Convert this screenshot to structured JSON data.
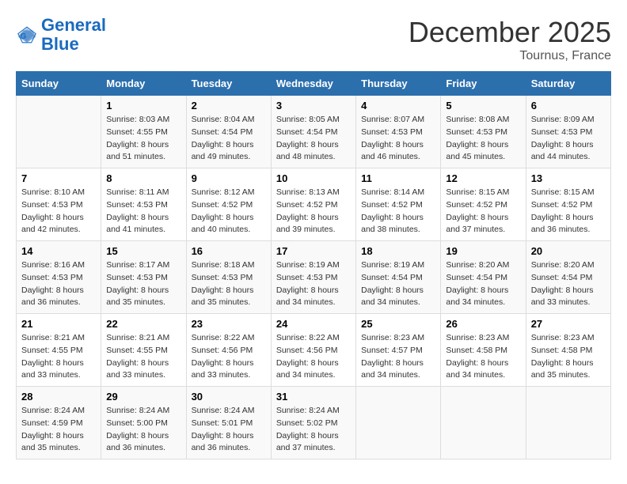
{
  "header": {
    "logo_general": "General",
    "logo_blue": "Blue",
    "month": "December 2025",
    "location": "Tournus, France"
  },
  "days_of_week": [
    "Sunday",
    "Monday",
    "Tuesday",
    "Wednesday",
    "Thursday",
    "Friday",
    "Saturday"
  ],
  "weeks": [
    [
      {
        "day": "",
        "sunrise": "",
        "sunset": "",
        "daylight": ""
      },
      {
        "day": "1",
        "sunrise": "Sunrise: 8:03 AM",
        "sunset": "Sunset: 4:55 PM",
        "daylight": "Daylight: 8 hours and 51 minutes."
      },
      {
        "day": "2",
        "sunrise": "Sunrise: 8:04 AM",
        "sunset": "Sunset: 4:54 PM",
        "daylight": "Daylight: 8 hours and 49 minutes."
      },
      {
        "day": "3",
        "sunrise": "Sunrise: 8:05 AM",
        "sunset": "Sunset: 4:54 PM",
        "daylight": "Daylight: 8 hours and 48 minutes."
      },
      {
        "day": "4",
        "sunrise": "Sunrise: 8:07 AM",
        "sunset": "Sunset: 4:53 PM",
        "daylight": "Daylight: 8 hours and 46 minutes."
      },
      {
        "day": "5",
        "sunrise": "Sunrise: 8:08 AM",
        "sunset": "Sunset: 4:53 PM",
        "daylight": "Daylight: 8 hours and 45 minutes."
      },
      {
        "day": "6",
        "sunrise": "Sunrise: 8:09 AM",
        "sunset": "Sunset: 4:53 PM",
        "daylight": "Daylight: 8 hours and 44 minutes."
      }
    ],
    [
      {
        "day": "7",
        "sunrise": "Sunrise: 8:10 AM",
        "sunset": "Sunset: 4:53 PM",
        "daylight": "Daylight: 8 hours and 42 minutes."
      },
      {
        "day": "8",
        "sunrise": "Sunrise: 8:11 AM",
        "sunset": "Sunset: 4:53 PM",
        "daylight": "Daylight: 8 hours and 41 minutes."
      },
      {
        "day": "9",
        "sunrise": "Sunrise: 8:12 AM",
        "sunset": "Sunset: 4:52 PM",
        "daylight": "Daylight: 8 hours and 40 minutes."
      },
      {
        "day": "10",
        "sunrise": "Sunrise: 8:13 AM",
        "sunset": "Sunset: 4:52 PM",
        "daylight": "Daylight: 8 hours and 39 minutes."
      },
      {
        "day": "11",
        "sunrise": "Sunrise: 8:14 AM",
        "sunset": "Sunset: 4:52 PM",
        "daylight": "Daylight: 8 hours and 38 minutes."
      },
      {
        "day": "12",
        "sunrise": "Sunrise: 8:15 AM",
        "sunset": "Sunset: 4:52 PM",
        "daylight": "Daylight: 8 hours and 37 minutes."
      },
      {
        "day": "13",
        "sunrise": "Sunrise: 8:15 AM",
        "sunset": "Sunset: 4:52 PM",
        "daylight": "Daylight: 8 hours and 36 minutes."
      }
    ],
    [
      {
        "day": "14",
        "sunrise": "Sunrise: 8:16 AM",
        "sunset": "Sunset: 4:53 PM",
        "daylight": "Daylight: 8 hours and 36 minutes."
      },
      {
        "day": "15",
        "sunrise": "Sunrise: 8:17 AM",
        "sunset": "Sunset: 4:53 PM",
        "daylight": "Daylight: 8 hours and 35 minutes."
      },
      {
        "day": "16",
        "sunrise": "Sunrise: 8:18 AM",
        "sunset": "Sunset: 4:53 PM",
        "daylight": "Daylight: 8 hours and 35 minutes."
      },
      {
        "day": "17",
        "sunrise": "Sunrise: 8:19 AM",
        "sunset": "Sunset: 4:53 PM",
        "daylight": "Daylight: 8 hours and 34 minutes."
      },
      {
        "day": "18",
        "sunrise": "Sunrise: 8:19 AM",
        "sunset": "Sunset: 4:54 PM",
        "daylight": "Daylight: 8 hours and 34 minutes."
      },
      {
        "day": "19",
        "sunrise": "Sunrise: 8:20 AM",
        "sunset": "Sunset: 4:54 PM",
        "daylight": "Daylight: 8 hours and 34 minutes."
      },
      {
        "day": "20",
        "sunrise": "Sunrise: 8:20 AM",
        "sunset": "Sunset: 4:54 PM",
        "daylight": "Daylight: 8 hours and 33 minutes."
      }
    ],
    [
      {
        "day": "21",
        "sunrise": "Sunrise: 8:21 AM",
        "sunset": "Sunset: 4:55 PM",
        "daylight": "Daylight: 8 hours and 33 minutes."
      },
      {
        "day": "22",
        "sunrise": "Sunrise: 8:21 AM",
        "sunset": "Sunset: 4:55 PM",
        "daylight": "Daylight: 8 hours and 33 minutes."
      },
      {
        "day": "23",
        "sunrise": "Sunrise: 8:22 AM",
        "sunset": "Sunset: 4:56 PM",
        "daylight": "Daylight: 8 hours and 33 minutes."
      },
      {
        "day": "24",
        "sunrise": "Sunrise: 8:22 AM",
        "sunset": "Sunset: 4:56 PM",
        "daylight": "Daylight: 8 hours and 34 minutes."
      },
      {
        "day": "25",
        "sunrise": "Sunrise: 8:23 AM",
        "sunset": "Sunset: 4:57 PM",
        "daylight": "Daylight: 8 hours and 34 minutes."
      },
      {
        "day": "26",
        "sunrise": "Sunrise: 8:23 AM",
        "sunset": "Sunset: 4:58 PM",
        "daylight": "Daylight: 8 hours and 34 minutes."
      },
      {
        "day": "27",
        "sunrise": "Sunrise: 8:23 AM",
        "sunset": "Sunset: 4:58 PM",
        "daylight": "Daylight: 8 hours and 35 minutes."
      }
    ],
    [
      {
        "day": "28",
        "sunrise": "Sunrise: 8:24 AM",
        "sunset": "Sunset: 4:59 PM",
        "daylight": "Daylight: 8 hours and 35 minutes."
      },
      {
        "day": "29",
        "sunrise": "Sunrise: 8:24 AM",
        "sunset": "Sunset: 5:00 PM",
        "daylight": "Daylight: 8 hours and 36 minutes."
      },
      {
        "day": "30",
        "sunrise": "Sunrise: 8:24 AM",
        "sunset": "Sunset: 5:01 PM",
        "daylight": "Daylight: 8 hours and 36 minutes."
      },
      {
        "day": "31",
        "sunrise": "Sunrise: 8:24 AM",
        "sunset": "Sunset: 5:02 PM",
        "daylight": "Daylight: 8 hours and 37 minutes."
      },
      {
        "day": "",
        "sunrise": "",
        "sunset": "",
        "daylight": ""
      },
      {
        "day": "",
        "sunrise": "",
        "sunset": "",
        "daylight": ""
      },
      {
        "day": "",
        "sunrise": "",
        "sunset": "",
        "daylight": ""
      }
    ]
  ]
}
